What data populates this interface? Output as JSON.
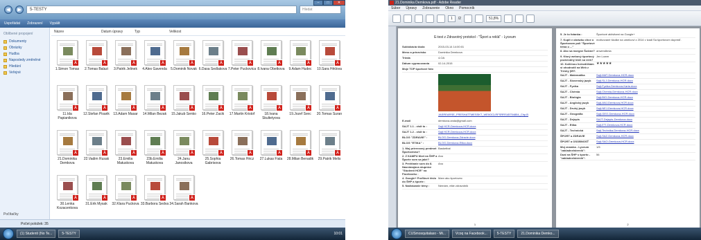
{
  "explorer": {
    "address": "5-TESTY",
    "search_placeholder": "Hledat",
    "toolbar": [
      "Uspořádat",
      "Zobrazení",
      "Vypálit"
    ],
    "columns": [
      "Název",
      "Datum úpravy",
      "Typ",
      "Velikost"
    ],
    "sidebar": {
      "heading": "Oblíbené propojení",
      "items": [
        "Dokumenty",
        "Obrázky",
        "Hudba",
        "Naposledy změněné",
        "Hledání",
        "Veřejné"
      ],
      "footer": "Počítačky"
    },
    "files": [
      "1.Simon Tomas",
      "2.Tomas Balazi",
      "3.Patrik Jelinek",
      "4.Alex Gavenda",
      "5.Dominik Novak",
      "6.Dasa Sedlakova",
      "7.Peter Puckovica",
      "8.Ivana Obetkova",
      "9.Adam Hudec",
      "10.Sara Hrklova",
      "11.Ida Papianikova",
      "12.Stefan Pisarik",
      "13.Adam Masar",
      "14.Milan Bezak",
      "15.Jakub Senko",
      "16.Peter Zacik",
      "17.Martin Kristof",
      "18.Ivana Skultetyova",
      "19.Jozef Svec",
      "20.Tomas Suran",
      "21.Dominika Demkova",
      "22.Vadim Rusak",
      "23.Emilia Matuskova",
      "23b.Emilia Matuskova",
      "24.Janu Janosikova",
      "25.Sophia Gabrisova",
      "26.Tomas Hricz",
      "27.Lukas Fiala",
      "28.Milan Benadik",
      "29.Patrik Melis",
      "30.Lenka Kozacenkova",
      "31.Erik Mysak",
      "32.Klara Puckova",
      "33.Barbora Sedva",
      "34.Sarah Bankova"
    ],
    "status": "Počet položek: 35",
    "taskbar": [
      "(1) Studentí (No Te...",
      "5-TESTY"
    ],
    "clock": "10:01"
  },
  "reader": {
    "title": "21.Dominika Demkova.pdf - Adobe Reader",
    "menu": [
      "Súbor",
      "Úpravy",
      "Zobrazenie",
      "Okno",
      "Pomocník"
    ],
    "page_field": "1",
    "page_total": "/2",
    "zoom": "51,8%",
    "doc_title": "E-test z Zdravotný protokol - \"Šport a reklá\" - Lyceum",
    "left_rows": [
      {
        "k": "Sublokácia škola",
        "v": "2015-03-14 14:00:01"
      },
      {
        "k": "Meno a priezvisko",
        "v": "Dominika Demkova"
      },
      {
        "k": "Trieda",
        "v": "4.OA"
      },
      {
        "k": "Dátum vypracovania",
        "v": "02-14-2015"
      },
      {
        "k": "Moje TOP športové foto",
        "v": ""
      }
    ],
    "photo_link": "JASREARSE_FRESHATTMESSKT_WEIIOCLRFSRRS45754854_Chp.B",
    "left_rows_2": [
      {
        "k": "E-mail",
        "v": "demkova.anda@gmail.com",
        "link": false
      },
      {
        "k": "SAJT 1.1 - visit to :",
        "v": "Sajt HCR-Demkova-HCR.docx",
        "link": true
      },
      {
        "k": "SAJT 1.2 - visit to :",
        "v": "Sajt HCR-Demkova-HCR.docx",
        "link": true
      },
      {
        "k": "BLOG \"ZDRAVIE\" :",
        "v": "BLOG-Demkova-Zdravie.docx",
        "link": true
      },
      {
        "k": "BLOG \"ETIKA\" :",
        "v": "BLOG-Demkova-Etika.docx",
        "link": true
      },
      {
        "k": "1. Moj prierezový predmet Športovisko?",
        "v": "Basketbal",
        "link": false
      },
      {
        "k": "2. Z KAMPU tiket na ŠHP a Športe som sa jaké?",
        "v": "Ano",
        "link": false
      },
      {
        "k": "3. Prečítanie som do 8. Nasnímajúca stupnice \"Studenti HCR\" na Facebooku :",
        "v": "Ano",
        "link": false
      },
      {
        "k": "4. Google+ Profilové číslo do ŠHP a športe :",
        "v": "Mam aku športovec",
        "link": false
      },
      {
        "k": "5. Nadvázanie témy :",
        "v": "Nemám, ešte zdravotnik",
        "link": false
      }
    ],
    "right_rows": [
      {
        "k": "5. Je to fotanka :",
        "v": "Športové aktivitami na Google+",
        "link": false
      },
      {
        "k": "7. Kupit v obrázku chce o Športovom poli \"Športové téma o ...\"",
        "v": "motivované školke na umelcovi z 2014 v izadi Sa športovom dopredľ.",
        "link": false
      },
      {
        "k": "8. Ako sa morgne Šušme?",
        "v": "anwendbnia",
        "link": false
      },
      {
        "k": "9. Ktorý webový športový pozíciodný bloh sa vieš?",
        "v": "Jen Lowm",
        "link": false
      },
      {
        "k": "10. Količnou hviezdičkám si ohodnotil na Web z Tresky (MY:",
        "v": "★★★★★",
        "link": false
      },
      {
        "k": "SAJT - Matematika",
        "v": "Sajt-MAT-Demkova-HCR.docx",
        "link": true
      },
      {
        "k": "SAJT - Slovenský jazyk",
        "v": "Sajt-SLJ-Demkova-HCR.docx",
        "link": true
      },
      {
        "k": "SAJT - Fyzika",
        "v": "Sajt-Fyzika-Demkova-Karta.docx",
        "link": true
      },
      {
        "k": "SAJT - Chémia",
        "v": "Sajt-Chemia-Demkova-HCR.docx",
        "link": true
      },
      {
        "k": "SAJT - Biológia",
        "v": "Sajt-BIO-Demkova-HCR.docx",
        "link": true
      },
      {
        "k": "SAJT - Anglický jazyk",
        "v": "Sajt-ANJ-Demkova-HCR.docx",
        "link": true
      },
      {
        "k": "SAJT - Druhý jazyk",
        "v": "Sajt-NEJ-Demkova-HCR.docx",
        "link": true
      },
      {
        "k": "SAJT - Geografia",
        "v": "Sajt-GEO-Demkova-HCR.docx",
        "link": true
      },
      {
        "k": "SAJT - Dejepis",
        "v": "SAJT-Dejepis-Demkova.docx",
        "link": true
      },
      {
        "k": "SAJT - Etika",
        "v": "Sajt-ETI-Demkova-HCR.docx",
        "link": true
      },
      {
        "k": "SAJT - Technická",
        "v": "Sajt-Technika-Demkova-HCR.docx",
        "link": true
      },
      {
        "k": "ŠPORT a ZDRAVIE",
        "v": "Sajt-SAZ-Demkova-HCR.docx",
        "link": true
      },
      {
        "k": "ŠPORT a OSOBNOSŤ",
        "v": "Sajt-SAO-Demkova-HCR.docx",
        "link": true
      },
      {
        "k": "Moj znamka - Lyceum \"zakladnelsternik\":",
        "v": "1/5",
        "link": false
      },
      {
        "k": "Dual na ŠHP s športo - \"zakladnelsternik\":",
        "v": "56",
        "link": false
      }
    ],
    "page1": "1",
    "page2": "2",
    "taskbar": [
      "CUSmosquitalaso - Mi...",
      "Vcoq na Facebook...",
      "5-TESTY",
      "21.Dominika Demko..."
    ]
  },
  "colors": {
    "accent": "#3a6598",
    "pdf_red": "#d0221c",
    "link": "#2236b8"
  }
}
